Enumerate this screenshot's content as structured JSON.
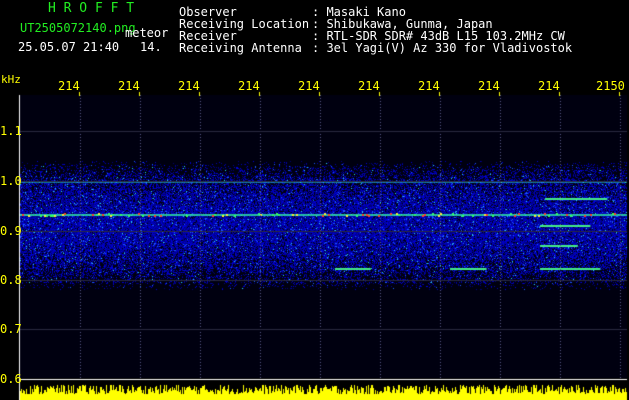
{
  "header": {
    "brand": "H R O F F T",
    "filename": "UT2505072140.png",
    "meteor_label": "meteor",
    "datetime": "25.05.07 21:40",
    "count": "14.",
    "info": [
      {
        "label": "Observer",
        "value": ": Masaki Kano"
      },
      {
        "label": "Receiving Location",
        "value": ": Shibukawa, Gunma, Japan"
      },
      {
        "label": "Receiver",
        "value": ": RTL-SDR SDR# 43dB L15 103.2MHz CW"
      },
      {
        "label": "Receiving Antenna",
        "value": ": 3el Yagi(V) Az 330 for Vladivostok"
      }
    ]
  },
  "axis": {
    "unit": "kHz",
    "freq_ticks": [
      "1.1",
      "1.0",
      "0.9",
      "0.8",
      "0.7",
      "0.6"
    ],
    "minute_ticks": [
      "214",
      "214",
      "214",
      "214",
      "214",
      "214",
      "214",
      "214",
      "214",
      "2150"
    ]
  },
  "colors": {
    "header_green": "#22ee22",
    "header_white": "#ffffff",
    "axis_yellow": "#ffff00",
    "background": "#000000",
    "spectrogram_base": "#00008b"
  }
}
